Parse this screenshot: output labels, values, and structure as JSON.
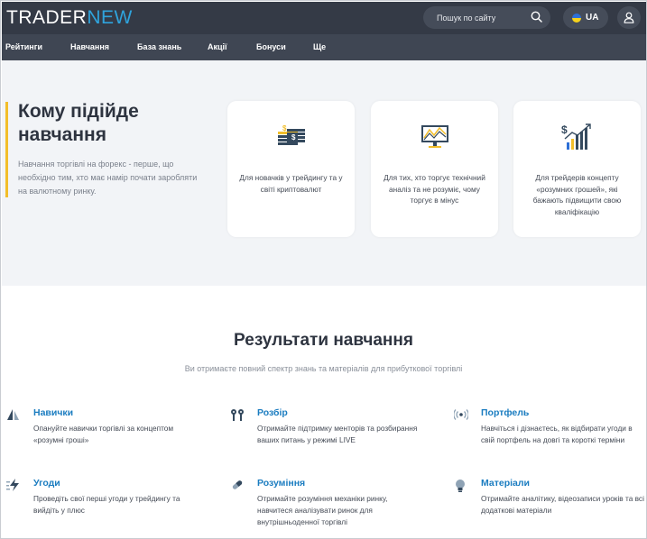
{
  "header": {
    "logo_part1": "TRADER",
    "logo_part2": "NEW",
    "search_placeholder": "Пошук по сайту",
    "lang": "UA"
  },
  "nav": [
    {
      "label": "Рейтинги"
    },
    {
      "label": "Навчання"
    },
    {
      "label": "База знань"
    },
    {
      "label": "Акції"
    },
    {
      "label": "Бонуси"
    },
    {
      "label": "Ще"
    }
  ],
  "hero": {
    "title": "Кому підійде навчання",
    "description": "Навчання торгівлі на форекс - перше, що необхідно тим, хто має намір почати заробляти на валютному ринку.",
    "cards": [
      {
        "icon": "money-stack-icon",
        "text": "Для новачків у трейдингу та у світі криптовалют"
      },
      {
        "icon": "monitor-chart-icon",
        "text": "Для тих, хто торгує технічний аналіз та не розуміє, чому торгує в мінус"
      },
      {
        "icon": "growth-chart-icon",
        "text": "Для трейдерів концепту «розумних грошей», які бажають підвищити свою кваліфікацію"
      }
    ]
  },
  "results": {
    "title": "Результати навчання",
    "subtitle": "Ви отримаєте повний спектр знань та матеріалів для прибуткової торгівлі",
    "items": [
      {
        "icon": "sail-icon",
        "title": "Навички",
        "text": "Опануйте навички торгівлі за концептом «розумні гроші»"
      },
      {
        "icon": "earbuds-icon",
        "title": "Розбір",
        "text": "Отримайте підтримку менторів та розбирання ваших питань у режимі LIVE"
      },
      {
        "icon": "broadcast-icon",
        "title": "Портфель",
        "text": "Навчіться і дізнаєтесь, як відбирати угоди в свій портфель на довгі та короткі терміни"
      },
      {
        "icon": "lightning-icon",
        "title": "Угоди",
        "text": "Проведіть свої перші угоди у трейдингу та вийдіть у плюс"
      },
      {
        "icon": "pill-icon",
        "title": "Розуміння",
        "text": "Отримайте розуміння механіки ринку, навчитеся аналізувати ринок для внутрішньоденної торгівлі"
      },
      {
        "icon": "bulb-icon",
        "title": "Матеріали",
        "text": "Отримайте аналітику, відеозаписи уроків та всі додаткові матеріали"
      }
    ]
  },
  "colors": {
    "header_bg": "#343a46",
    "nav_bg": "#3f4653",
    "accent_blue": "#1a7cc0",
    "accent_yellow": "#f2be2a",
    "hero_bg": "#f2f4f7"
  }
}
